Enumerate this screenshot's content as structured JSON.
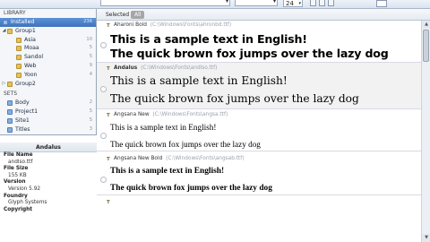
{
  "toolbar": {
    "size_value": "24",
    "size_arrow": "▾"
  },
  "sidebar": {
    "library_label": "LIBRARY",
    "items": [
      {
        "label": "Installed",
        "count": "236",
        "selected": true
      },
      {
        "label": "Group1",
        "count": "",
        "selected": false
      },
      {
        "label": "Asia",
        "count": "10",
        "selected": false
      },
      {
        "label": "Moaa",
        "count": "5",
        "selected": false
      },
      {
        "label": "Sandol",
        "count": "5",
        "selected": false
      },
      {
        "label": "Web",
        "count": "9",
        "selected": false
      },
      {
        "label": "Yoon",
        "count": "4",
        "selected": false
      },
      {
        "label": "Group2",
        "count": "",
        "selected": false
      }
    ],
    "sets_label": "SETS",
    "sets": [
      {
        "label": "Body",
        "count": "2"
      },
      {
        "label": "Project1",
        "count": "5"
      },
      {
        "label": "Site1",
        "count": "5"
      },
      {
        "label": "Titles",
        "count": "3"
      }
    ]
  },
  "properties": {
    "title": "Andalus",
    "rows": [
      {
        "key": "File Name",
        "value": "andlso.ttf"
      },
      {
        "key": "File Size",
        "value": "155 KB"
      },
      {
        "key": "Version",
        "value": "Version 5.92"
      },
      {
        "key": "Foundry",
        "value": "Glyph Systems"
      },
      {
        "key": "Copyright",
        "value": ""
      }
    ]
  },
  "filter": {
    "selected_label": "Selected",
    "all_label": "All"
  },
  "fonts": [
    {
      "name": "Aharoni Bold",
      "path": "(C:\\Windows\\Fonts\\ahronbd.ttf)",
      "bold_name": false,
      "selected": false,
      "line1": "This is a sample text in English!",
      "line2": "The quick brown fox jumps over the lazy dog"
    },
    {
      "name": "Andalus",
      "path": "(C:\\Windows\\Fonts\\andlso.ttf)",
      "bold_name": true,
      "selected": true,
      "line1": "This is a sample text in English!",
      "line2": "The quick brown fox jumps over the lazy dog"
    },
    {
      "name": "Angsana New",
      "path": "(C:\\Windows\\Fonts\\angsa.ttf)",
      "bold_name": false,
      "selected": false,
      "line1": "This is a sample text in English!",
      "line2": "The quick brown fox jumps over the lazy dog"
    },
    {
      "name": "Angsana New Bold",
      "path": "(C:\\Windows\\Fonts\\angsab.ttf)",
      "bold_name": false,
      "selected": false,
      "line1": "This is a sample text in English!",
      "line2": "The quick brown fox jumps over the lazy dog"
    }
  ],
  "icons": {
    "font_type": "font-file-icon",
    "chevron": "chevron-down-icon"
  }
}
